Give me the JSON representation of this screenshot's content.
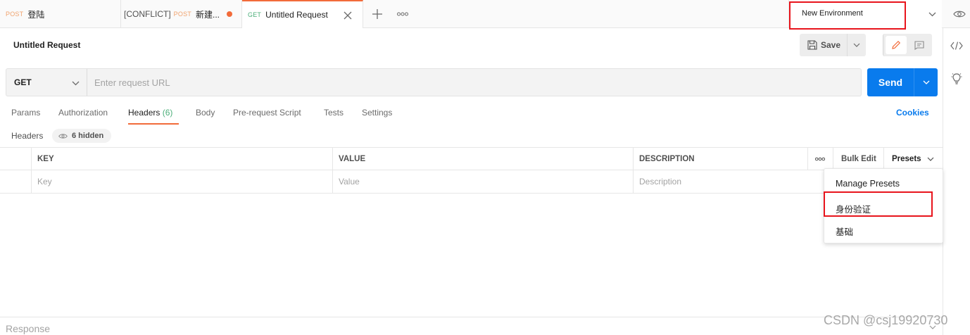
{
  "tabs": [
    {
      "method": "POST",
      "name": "登陆"
    },
    {
      "prefix": "[CONFLICT]",
      "method": "POST",
      "name": "新建..."
    },
    {
      "method": "GET",
      "name": "Untitled Request"
    }
  ],
  "environment": {
    "selected": "New Environment"
  },
  "request": {
    "title": "Untitled Request",
    "save_label": "Save",
    "method": "GET",
    "url_placeholder": "Enter request URL",
    "send_label": "Send"
  },
  "request_tabs": {
    "params": "Params",
    "authorization": "Authorization",
    "headers": "Headers",
    "headers_count": "(6)",
    "body": "Body",
    "prerequest": "Pre-request Script",
    "tests": "Tests",
    "settings": "Settings",
    "cookies": "Cookies"
  },
  "headers_section": {
    "label": "Headers",
    "hidden": "6 hidden"
  },
  "table": {
    "columns": [
      "KEY",
      "VALUE",
      "DESCRIPTION"
    ],
    "bulk_edit": "Bulk Edit",
    "presets": "Presets",
    "placeholders": {
      "key": "Key",
      "value": "Value",
      "description": "Description"
    }
  },
  "presets_menu": {
    "items": [
      "Manage Presets",
      "身份验证",
      "基础"
    ]
  },
  "response": {
    "label": "Response"
  },
  "watermark": "CSDN @csj19920730",
  "colors": {
    "accent": "#f26b3a",
    "primary": "#097bed",
    "highlight_box": "#e8141c",
    "get_method": "#4caf7a",
    "post_method": "#f0a36e"
  }
}
